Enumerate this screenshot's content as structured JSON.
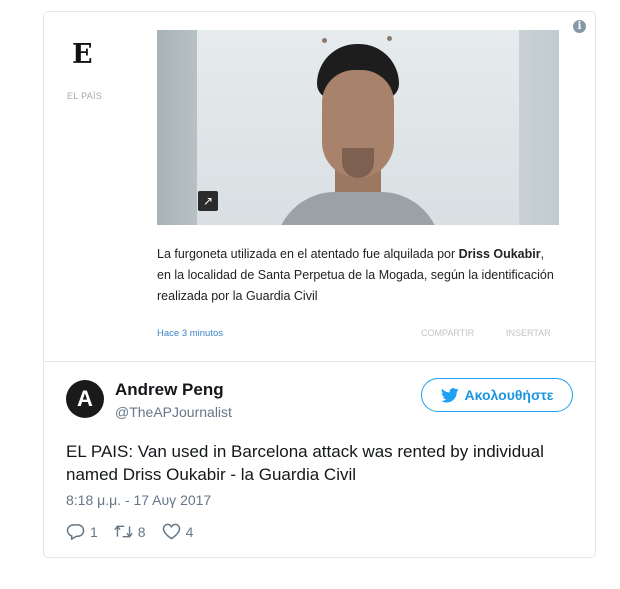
{
  "embed": {
    "info_icon": "i",
    "source_logo": "E",
    "source_name": "EL PAÍS",
    "article": {
      "text_before": "La furgoneta utilizada en el atentado fue alquilada por ",
      "bold_name": "Driss Oukabir",
      "text_after": ", en la localidad de Santa Perpetua de la Mogada, según la identificación realizada por la Guardia Civil"
    },
    "time_ago": "Hace 3 minutos",
    "share_label": "COMPARTIR",
    "embed_label": "INSERTAR"
  },
  "tweet": {
    "avatar_letter": "A",
    "author_name": "Andrew Peng",
    "author_handle": "@TheAPJournalist",
    "follow_label": "Ακολουθήστε",
    "text": "EL PAIS: Van used in Barcelona attack was rented by individual named Driss Oukabir - la Guardia Civil",
    "timestamp": "8:18 μ.μ. - 17 Αυγ 2017",
    "replies": "1",
    "retweets": "8",
    "likes": "4"
  },
  "colors": {
    "twitter_blue": "#1da1f2",
    "link_blue": "#3b84c4",
    "muted_gray": "#657786"
  }
}
